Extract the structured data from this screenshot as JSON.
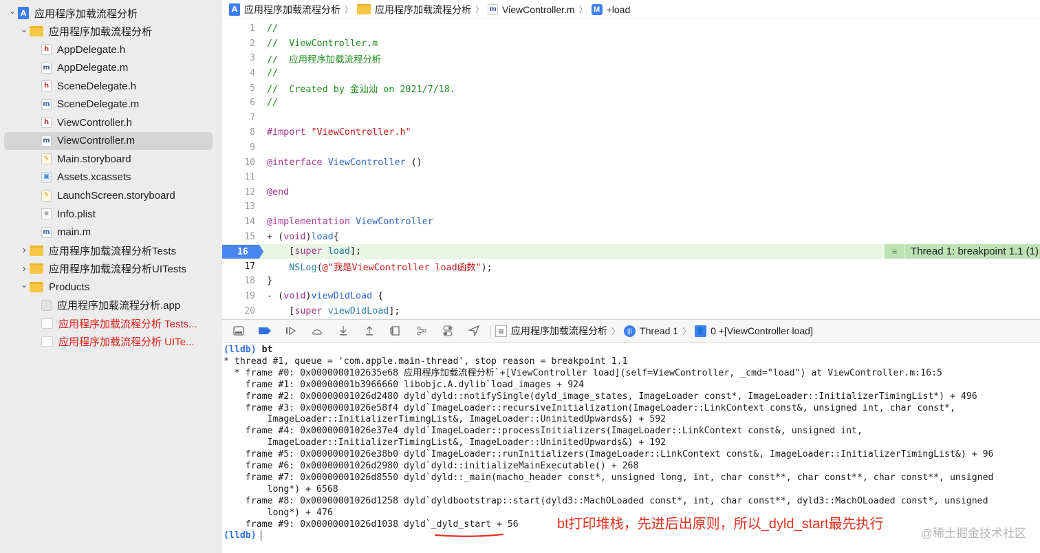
{
  "navigator": {
    "items": [
      {
        "label": "应用程序加载流程分析",
        "icon": "project-icon",
        "kind": "proj",
        "disclosure": "expanded",
        "indent": 0
      },
      {
        "label": "应用程序加载流程分析",
        "icon": "folder-icon",
        "kind": "folder",
        "disclosure": "expanded",
        "indent": 1
      },
      {
        "label": "AppDelegate.h",
        "icon": "header-file-icon",
        "kind": "h",
        "glyph": "h",
        "indent": 2
      },
      {
        "label": "AppDelegate.m",
        "icon": "objc-file-icon",
        "kind": "m",
        "glyph": "m",
        "indent": 2
      },
      {
        "label": "SceneDelegate.h",
        "icon": "header-file-icon",
        "kind": "h",
        "glyph": "h",
        "indent": 2
      },
      {
        "label": "SceneDelegate.m",
        "icon": "objc-file-icon",
        "kind": "m",
        "glyph": "m",
        "indent": 2
      },
      {
        "label": "ViewController.h",
        "icon": "header-file-icon",
        "kind": "h",
        "glyph": "h",
        "indent": 2
      },
      {
        "label": "ViewController.m",
        "icon": "objc-file-icon",
        "kind": "m",
        "glyph": "m",
        "indent": 2,
        "selected": true
      },
      {
        "label": "Main.storyboard",
        "icon": "storyboard-icon",
        "kind": "sb",
        "indent": 2
      },
      {
        "label": "Assets.xcassets",
        "icon": "asset-catalog-icon",
        "kind": "xc",
        "indent": 2
      },
      {
        "label": "LaunchScreen.storyboard",
        "icon": "storyboard-icon",
        "kind": "sb",
        "indent": 2
      },
      {
        "label": "Info.plist",
        "icon": "plist-icon",
        "kind": "pl",
        "indent": 2
      },
      {
        "label": "main.m",
        "icon": "objc-file-icon",
        "kind": "m",
        "glyph": "m",
        "indent": 2
      },
      {
        "label": "应用程序加载流程分析Tests",
        "icon": "folder-icon",
        "kind": "folder",
        "disclosure": "collapsed",
        "indent": 1
      },
      {
        "label": "应用程序加载流程分析UITests",
        "icon": "folder-icon",
        "kind": "folder",
        "disclosure": "collapsed",
        "indent": 1
      },
      {
        "label": "Products",
        "icon": "folder-icon",
        "kind": "folder",
        "disclosure": "expanded",
        "indent": 1
      },
      {
        "label": "应用程序加载流程分析.app",
        "icon": "app-icon",
        "kind": "app",
        "indent": 2
      },
      {
        "label": "应用程序加载流程分析 Tests...",
        "icon": "bundle-icon",
        "kind": "blank",
        "indent": 2,
        "red": true
      },
      {
        "label": "应用程序加载流程分析 UITe...",
        "icon": "bundle-icon",
        "kind": "blank",
        "indent": 2,
        "red": true
      }
    ]
  },
  "breadcrumb": {
    "project": "应用程序加载流程分析",
    "group": "应用程序加载流程分析",
    "file": "ViewController.m",
    "method_badge": "M",
    "method": "+load"
  },
  "editor": {
    "breakpoint_line": 16,
    "thread_badge": "Thread 1: breakpoint 1.1 (1)",
    "lines": [
      {
        "n": "1",
        "tokens": [
          {
            "t": "//",
            "c": "comment"
          }
        ]
      },
      {
        "n": "2",
        "tokens": [
          {
            "t": "//  ViewController.m",
            "c": "comment"
          }
        ]
      },
      {
        "n": "3",
        "tokens": [
          {
            "t": "//  应用程序加载流程分析",
            "c": "comment"
          }
        ]
      },
      {
        "n": "4",
        "tokens": [
          {
            "t": "//",
            "c": "comment"
          }
        ]
      },
      {
        "n": "5",
        "tokens": [
          {
            "t": "//  Created by 金汕汕 on 2021/7/18.",
            "c": "comment"
          }
        ]
      },
      {
        "n": "6",
        "tokens": [
          {
            "t": "//",
            "c": "comment"
          }
        ]
      },
      {
        "n": "7",
        "tokens": []
      },
      {
        "n": "8",
        "tokens": [
          {
            "t": "#import ",
            "c": "kw"
          },
          {
            "t": "\"ViewController.h\"",
            "c": "str"
          }
        ]
      },
      {
        "n": "9",
        "tokens": []
      },
      {
        "n": "10",
        "tokens": [
          {
            "t": "@interface ",
            "c": "kw"
          },
          {
            "t": "ViewController",
            "c": "type"
          },
          {
            "t": " ()",
            "c": "plain"
          }
        ]
      },
      {
        "n": "11",
        "tokens": []
      },
      {
        "n": "12",
        "tokens": [
          {
            "t": "@end",
            "c": "kw"
          }
        ]
      },
      {
        "n": "13",
        "tokens": []
      },
      {
        "n": "14",
        "tokens": [
          {
            "t": "@implementation ",
            "c": "kw"
          },
          {
            "t": "ViewController",
            "c": "type"
          }
        ]
      },
      {
        "n": "15",
        "tokens": [
          {
            "t": "+ (",
            "c": "plain"
          },
          {
            "t": "void",
            "c": "kw"
          },
          {
            "t": ")",
            "c": "plain"
          },
          {
            "t": "load",
            "c": "type"
          },
          {
            "t": "{",
            "c": "plain"
          }
        ]
      },
      {
        "n": "16",
        "tokens": [
          {
            "t": "    [",
            "c": "plain"
          },
          {
            "t": "super",
            "c": "kw"
          },
          {
            "t": " ",
            "c": "plain"
          },
          {
            "t": "load",
            "c": "fn"
          },
          {
            "t": "];",
            "c": "plain"
          }
        ]
      },
      {
        "n": "17",
        "tokens": [
          {
            "t": "    ",
            "c": "plain"
          },
          {
            "t": "NSLog",
            "c": "fn"
          },
          {
            "t": "(",
            "c": "plain"
          },
          {
            "t": "@\"我是ViewController load函数\"",
            "c": "str"
          },
          {
            "t": ");",
            "c": "plain"
          }
        ]
      },
      {
        "n": "18",
        "tokens": [
          {
            "t": "}",
            "c": "plain"
          }
        ]
      },
      {
        "n": "19",
        "tokens": [
          {
            "t": "- (",
            "c": "plain"
          },
          {
            "t": "void",
            "c": "kw"
          },
          {
            "t": ")",
            "c": "plain"
          },
          {
            "t": "viewDidLoad",
            "c": "type"
          },
          {
            "t": " {",
            "c": "plain"
          }
        ]
      },
      {
        "n": "20",
        "tokens": [
          {
            "t": "    [",
            "c": "plain"
          },
          {
            "t": "super",
            "c": "kw"
          },
          {
            "t": " ",
            "c": "plain"
          },
          {
            "t": "viewDidLoad",
            "c": "fn"
          },
          {
            "t": "];",
            "c": "plain"
          }
        ]
      }
    ]
  },
  "debugbar": {
    "scheme": "应用程序加载流程分析",
    "thread": "Thread 1",
    "frame": "0 +[ViewController load]"
  },
  "console": {
    "lines": [
      {
        "prompt": "(lldb)",
        "text": " bt",
        "bold": true
      },
      {
        "text": "* thread #1, queue = 'com.apple.main-thread', stop reason = breakpoint 1.1"
      },
      {
        "text": "  * frame #0: 0x0000000102635e68 应用程序加载流程分析`+[ViewController load](self=ViewController, _cmd=\"load\") at ViewController.m:16:5"
      },
      {
        "text": "    frame #1: 0x00000001b3966660 libobjc.A.dylib`load_images + 924"
      },
      {
        "text": "    frame #2: 0x00000001026d2480 dyld`dyld::notifySingle(dyld_image_states, ImageLoader const*, ImageLoader::InitializerTimingList*) + 496"
      },
      {
        "text": "    frame #3: 0x00000001026e58f4 dyld`ImageLoader::recursiveInitialization(ImageLoader::LinkContext const&, unsigned int, char const*,"
      },
      {
        "text": "        ImageLoader::InitializerTimingList&, ImageLoader::UninitedUpwards&) + 592"
      },
      {
        "text": "    frame #4: 0x00000001026e37e4 dyld`ImageLoader::processInitializers(ImageLoader::LinkContext const&, unsigned int,"
      },
      {
        "text": "        ImageLoader::InitializerTimingList&, ImageLoader::UninitedUpwards&) + 192"
      },
      {
        "text": "    frame #5: 0x00000001026e38b0 dyld`ImageLoader::runInitializers(ImageLoader::LinkContext const&, ImageLoader::InitializerTimingList&) + 96"
      },
      {
        "text": "    frame #6: 0x00000001026d2980 dyld`dyld::initializeMainExecutable() + 268"
      },
      {
        "text": "    frame #7: 0x00000001026d8550 dyld`dyld::_main(macho_header const*, unsigned long, int, char const**, char const**, char const**, unsigned"
      },
      {
        "text": "        long*) + 6568"
      },
      {
        "text": "    frame #8: 0x00000001026d1258 dyld`dyldbootstrap::start(dyld3::MachOLoaded const*, int, char const**, dyld3::MachOLoaded const*, unsigned"
      },
      {
        "text": "        long*) + 476"
      },
      {
        "text": "    frame #9: 0x00000001026d1038 dyld`_dyld_start + 56"
      },
      {
        "prompt": "(lldb)",
        "text": "",
        "cursor": true
      }
    ],
    "annotation": "bt打印堆栈，先进后出原则，所以_dyld_start最先执行",
    "watermark": "@稀土掘金技术社区"
  },
  "colors": {
    "breakpoint": "#4a86ef",
    "annotation": "#e33322",
    "error_text": "#e0201a"
  }
}
